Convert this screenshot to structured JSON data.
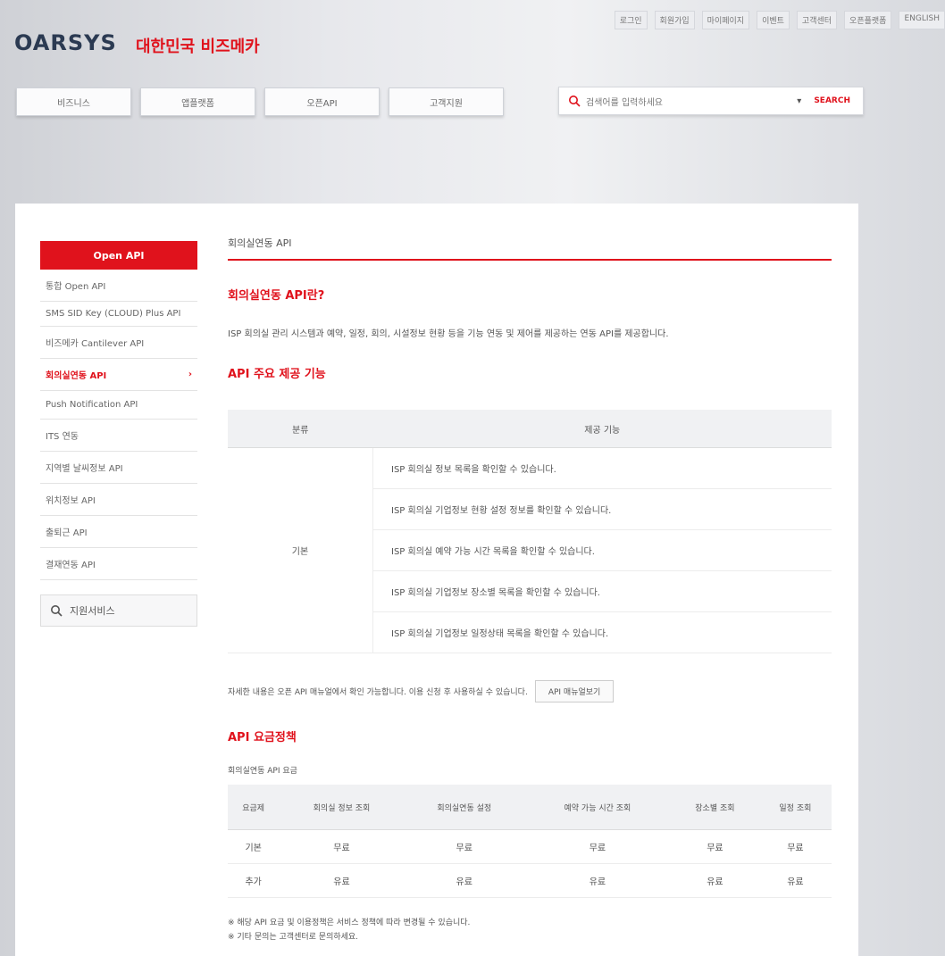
{
  "top_util": [
    "로그인",
    "회원가입",
    "마이페이지",
    "이벤트",
    "고객센터",
    "오픈플랫폼",
    "ENGLISH"
  ],
  "logo": {
    "name": "OARSYS",
    "sub": "대한민국 비즈메카"
  },
  "gnb": [
    "비즈니스",
    "앱플랫폼",
    "오픈API",
    "고객지원"
  ],
  "search": {
    "placeholder": "검색어를 입력하세요",
    "submit": "SEARCH"
  },
  "lnb": {
    "head": "Open API",
    "items": [
      {
        "label": "통합 Open API",
        "active": false
      },
      {
        "label": "SMS SID Key (CLOUD) Plus API",
        "active": false
      },
      {
        "label": "비즈메카 Cantilever API",
        "active": false
      },
      {
        "label": "회의실연동 API",
        "active": true,
        "arrow": "›"
      },
      {
        "label": "Push Notification API",
        "active": false
      },
      {
        "label": "ITS 연동",
        "active": false
      },
      {
        "label": "지역별 날씨정보 API",
        "active": false
      },
      {
        "label": "위치정보 API",
        "active": false
      },
      {
        "label": "출퇴근 API",
        "active": false
      },
      {
        "label": "결재연동 API",
        "active": false
      }
    ],
    "search_label": "지원서비스"
  },
  "main": {
    "page_title": "회의실연동 API",
    "section1_title": "회의실연동 API란?",
    "desc": "ISP 회의실 관리 시스템과 예약, 일정, 회의, 시설정보 현황 등을 기능 연동 및 제어를 제공하는 연동 API를 제공합니다.",
    "section2_title": "API 주요 제공 기능",
    "fn_table": {
      "headers": [
        "분류",
        "제공 기능"
      ],
      "category": "기본",
      "rows": [
        "ISP 회의실 정보 목록을 확인할 수 있습니다.",
        "ISP 회의실 기업정보 현황 설정 정보를 확인할 수 있습니다.",
        "ISP 회의실 예약 가능 시간 목록을 확인할 수 있습니다.",
        "ISP 회의실 기업정보 장소별 목록을 확인할 수 있습니다.",
        "ISP 회의실 기업정보 일정상태 목록을 확인할 수 있습니다."
      ]
    },
    "note": "자세한 내용은 오픈 API 매뉴얼에서 확인 가능합니다. 이용 신청 후 사용하실 수 있습니다.",
    "manual_button": "API 매뉴얼보기",
    "section3_title": "API 요금정책",
    "price_sublabel": "회의실연동 API 요금",
    "price_table": {
      "headers": [
        "요금제",
        "회의실 정보 조회",
        "회의실연동 설정",
        "예약 가능 시간 조회",
        "장소별 조회",
        "일정 조회"
      ],
      "rows": [
        [
          "기본",
          "무료",
          "무료",
          "무료",
          "무료",
          "무료"
        ],
        [
          "추가",
          "유료",
          "유료",
          "유료",
          "유료",
          "유료"
        ]
      ]
    },
    "foot_notes": [
      "※ 해당 API 요금 및 이용정책은 서비스 정책에 따라 변경될 수 있습니다.",
      "※ 기타 문의는 고객센터로 문의하세요."
    ]
  },
  "colors": {
    "accent": "#e0121c",
    "logo": "#2b3a52"
  }
}
